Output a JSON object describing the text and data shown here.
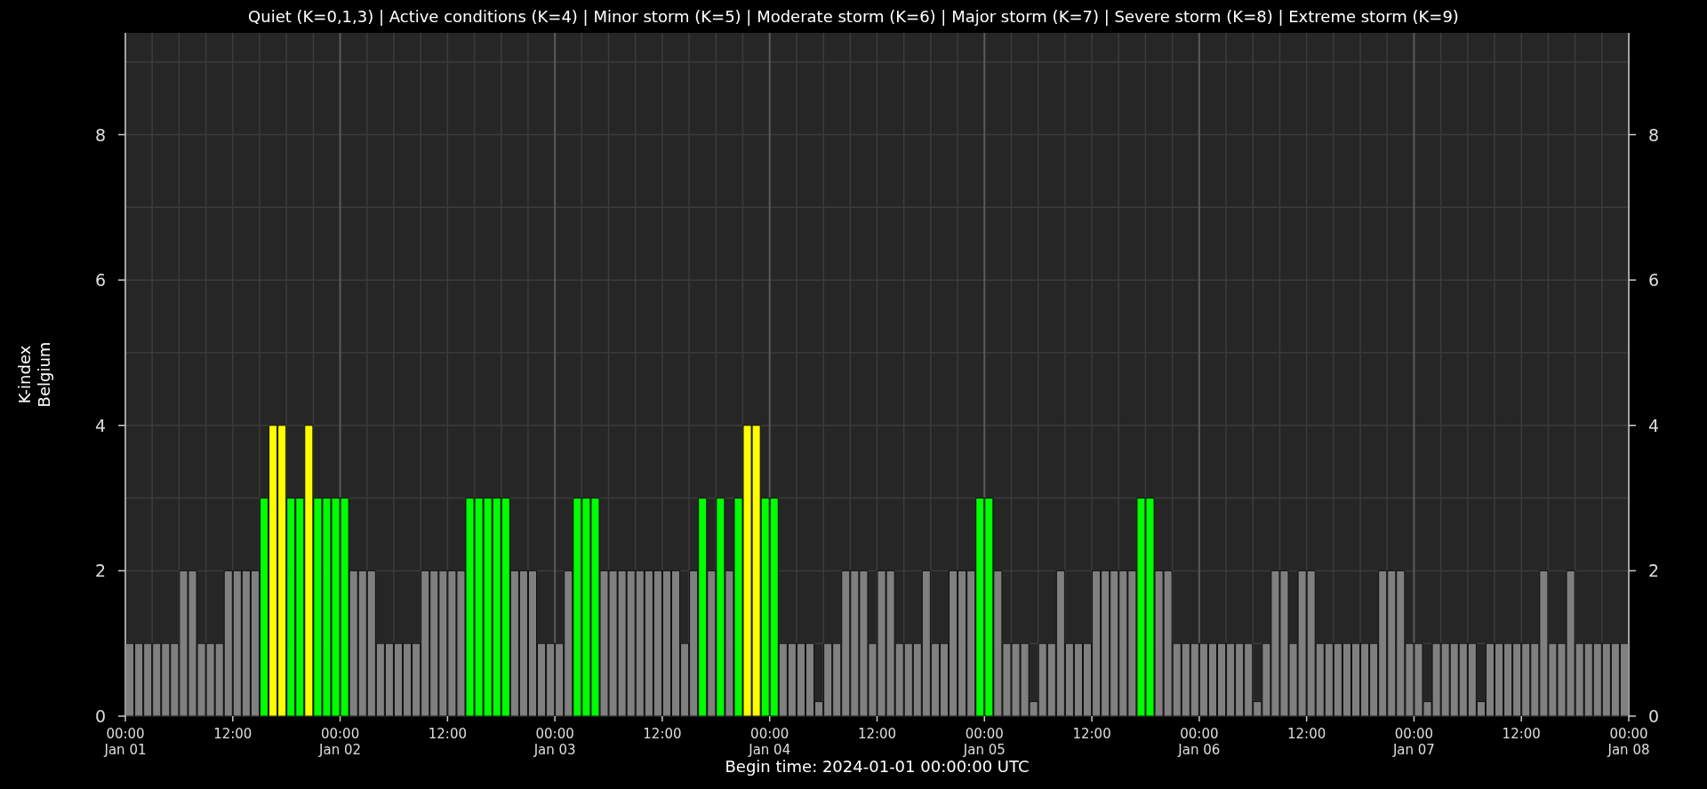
{
  "legend_title": "Quiet (K=0,1,3) | Active conditions (K=4) | Minor storm (K=5) | Moderate storm (K=6) | Major storm (K=7) | Severe storm (K=8) | Extreme storm (K=9)",
  "chart": {
    "axis_end_label": "00:00\nJan 08",
    "right_axis_ticks": [
      "8",
      "6",
      "4",
      "2",
      "0"
    ],
    "chart_data": {
      "type": "bar",
      "xlabel": "Begin time: 2024-01-01 00:00:00 UTC",
      "ylabel": "K-index\nBelgium",
      "grid": true,
      "ylim": [
        0,
        9.4
      ],
      "categories": [
        "00:00\nJan 01",
        null,
        null,
        null,
        null,
        null,
        null,
        null,
        null,
        null,
        null,
        null,
        "12:00",
        null,
        null,
        null,
        null,
        null,
        null,
        null,
        null,
        null,
        null,
        null,
        "00:00\nJan 02",
        null,
        null,
        null,
        null,
        null,
        null,
        null,
        null,
        null,
        null,
        null,
        "12:00",
        null,
        null,
        null,
        null,
        null,
        null,
        null,
        null,
        null,
        null,
        null,
        "00:00\nJan 03",
        null,
        null,
        null,
        null,
        null,
        null,
        null,
        null,
        null,
        null,
        null,
        "12:00",
        null,
        null,
        null,
        null,
        null,
        null,
        null,
        null,
        null,
        null,
        null,
        "00:00\nJan 04",
        null,
        null,
        null,
        null,
        null,
        null,
        null,
        null,
        null,
        null,
        null,
        "12:00",
        null,
        null,
        null,
        null,
        null,
        null,
        null,
        null,
        null,
        null,
        null,
        "00:00\nJan 05",
        null,
        null,
        null,
        null,
        null,
        null,
        null,
        null,
        null,
        null,
        null,
        "12:00",
        null,
        null,
        null,
        null,
        null,
        null,
        null,
        null,
        null,
        null,
        null,
        "00:00\nJan 06",
        null,
        null,
        null,
        null,
        null,
        null,
        null,
        null,
        null,
        null,
        null,
        "12:00",
        null,
        null,
        null,
        null,
        null,
        null,
        null,
        null,
        null,
        null,
        null,
        "00:00\nJan 07",
        null,
        null,
        null,
        null,
        null,
        null,
        null,
        null,
        null,
        null,
        null,
        "12:00",
        null,
        null,
        null,
        null,
        null,
        null,
        null,
        null,
        null,
        null,
        null
      ],
      "yticks": [
        0,
        2,
        4,
        6,
        8
      ],
      "series": [
        {
          "color": "#808080",
          "values": [
            1,
            1,
            1,
            1,
            1,
            1,
            2,
            2,
            1,
            1,
            1,
            2,
            2,
            2,
            2,
            null,
            null,
            null,
            null,
            null,
            null,
            null,
            null,
            null,
            null,
            2,
            2,
            2,
            1,
            1,
            1,
            1,
            1,
            2,
            2,
            2,
            2,
            2,
            null,
            null,
            null,
            null,
            null,
            2,
            2,
            2,
            1,
            1,
            1,
            2,
            null,
            null,
            null,
            2,
            2,
            2,
            2,
            2,
            2,
            2,
            2,
            2,
            1,
            2,
            null,
            2,
            null,
            2,
            null,
            null,
            null,
            null,
            null,
            1,
            1,
            1,
            1,
            0.2,
            1,
            1,
            2,
            2,
            2,
            1,
            2,
            2,
            1,
            1,
            1,
            2,
            1,
            1,
            2,
            2,
            2,
            null,
            null,
            2,
            1,
            1,
            1,
            0.2,
            1,
            1,
            2,
            1,
            1,
            1,
            2,
            2,
            2,
            2,
            2,
            null,
            null,
            2,
            2,
            1,
            1,
            1,
            1,
            1,
            1,
            1,
            1,
            1,
            0.2,
            1,
            2,
            2,
            1,
            2,
            2,
            1,
            1,
            1,
            1,
            1,
            1,
            1,
            2,
            2,
            2,
            1,
            1,
            0.2,
            1,
            1,
            1,
            1,
            1,
            0.2,
            1,
            1,
            1,
            1,
            1,
            1,
            2,
            1,
            1,
            2,
            1,
            1,
            1,
            1,
            1,
            1
          ]
        },
        {
          "color": "#00ff00",
          "values": [
            null,
            null,
            null,
            null,
            null,
            null,
            null,
            null,
            null,
            null,
            null,
            null,
            null,
            null,
            null,
            3,
            null,
            null,
            3,
            3,
            null,
            3,
            3,
            3,
            3,
            null,
            null,
            null,
            null,
            null,
            null,
            null,
            null,
            null,
            null,
            null,
            null,
            null,
            3,
            3,
            3,
            3,
            3,
            null,
            null,
            null,
            null,
            null,
            null,
            null,
            3,
            3,
            3,
            null,
            null,
            null,
            null,
            null,
            null,
            null,
            null,
            null,
            null,
            null,
            3,
            null,
            3,
            null,
            3,
            null,
            null,
            3,
            3,
            null,
            null,
            null,
            null,
            null,
            null,
            null,
            null,
            null,
            null,
            null,
            null,
            null,
            null,
            null,
            null,
            null,
            null,
            null,
            null,
            null,
            null,
            3,
            3,
            null,
            null,
            null,
            null,
            null,
            null,
            null,
            null,
            null,
            null,
            null,
            null,
            null,
            null,
            null,
            null,
            3,
            3,
            null,
            null,
            null,
            null,
            null,
            null,
            null,
            null,
            null,
            null,
            null,
            null,
            null,
            null,
            null,
            null,
            null,
            null,
            null,
            null,
            null,
            null,
            null,
            null,
            null,
            null,
            null,
            null,
            null,
            null,
            null,
            null,
            null,
            null,
            null,
            null,
            null,
            null,
            null,
            null,
            null,
            null,
            null,
            null,
            null,
            null,
            null,
            null,
            null,
            null,
            null,
            null,
            null
          ]
        },
        {
          "color": "#ffff00",
          "values": [
            null,
            null,
            null,
            null,
            null,
            null,
            null,
            null,
            null,
            null,
            null,
            null,
            null,
            null,
            null,
            null,
            4,
            4,
            null,
            null,
            4,
            null,
            null,
            null,
            null,
            null,
            null,
            null,
            null,
            null,
            null,
            null,
            null,
            null,
            null,
            null,
            null,
            null,
            null,
            null,
            null,
            null,
            null,
            null,
            null,
            null,
            null,
            null,
            null,
            null,
            null,
            null,
            null,
            null,
            null,
            null,
            null,
            null,
            null,
            null,
            null,
            null,
            null,
            null,
            null,
            null,
            null,
            null,
            null,
            4,
            4,
            null,
            null,
            null,
            null,
            null,
            null,
            null,
            null,
            null,
            null,
            null,
            null,
            null,
            null,
            null,
            null,
            null,
            null,
            null,
            null,
            null,
            null,
            null,
            null,
            null,
            null,
            null,
            null,
            null,
            null,
            null,
            null,
            null,
            null,
            null,
            null,
            null,
            null,
            null,
            null,
            null,
            null,
            null,
            null,
            null,
            null,
            null,
            null,
            null,
            null,
            null,
            null,
            null,
            null,
            null,
            null,
            null,
            null,
            null,
            null,
            null,
            null,
            null,
            null,
            null,
            null,
            null,
            null,
            null,
            null,
            null,
            null,
            null,
            null,
            null,
            null,
            null,
            null,
            null,
            null,
            null,
            null,
            null,
            null,
            null,
            null,
            null,
            null,
            null,
            null,
            null,
            null,
            null,
            null,
            null,
            null,
            null
          ]
        }
      ]
    }
  }
}
